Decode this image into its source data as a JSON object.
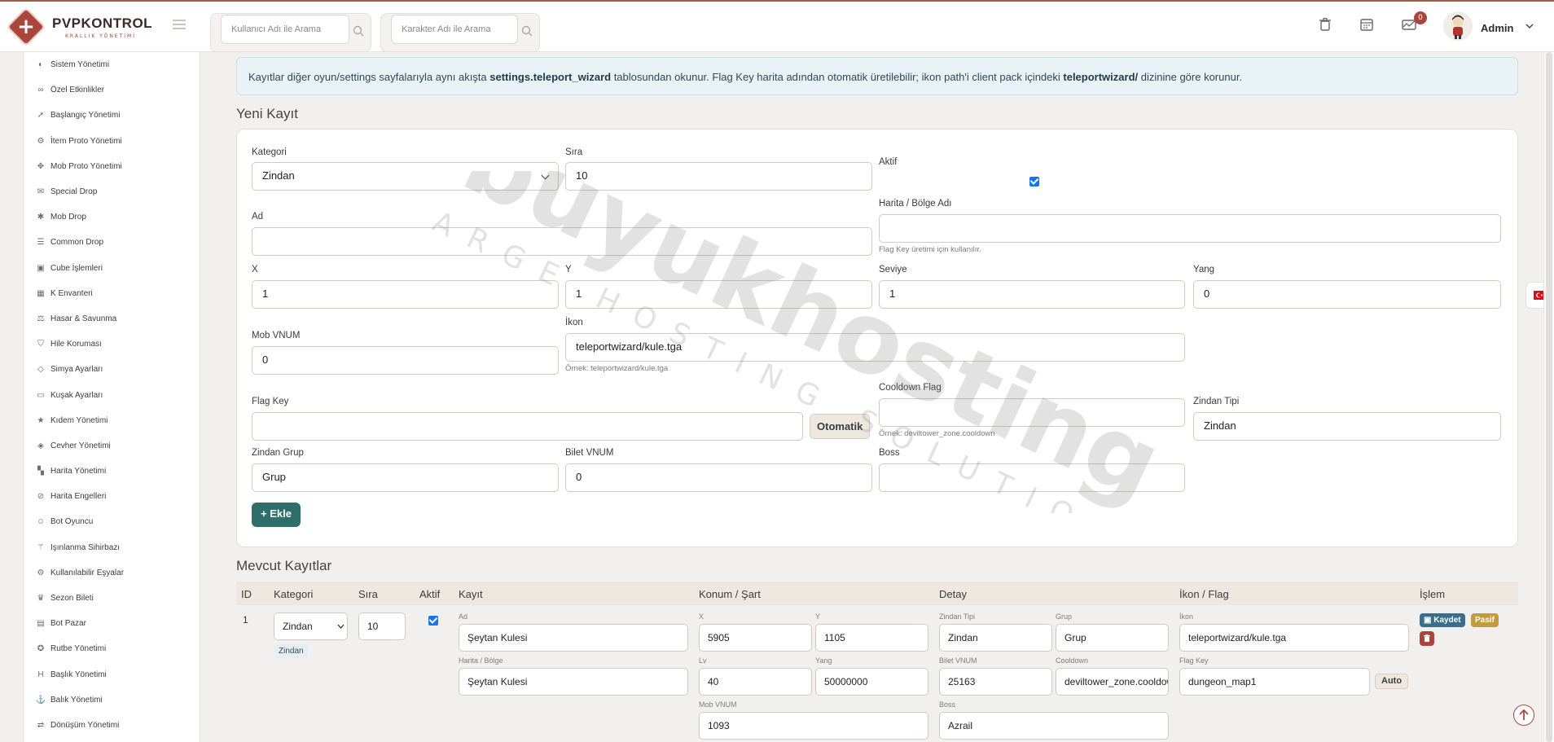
{
  "brand": {
    "title": "PVPKONTROL",
    "subtitle": "KRALLIK YÖNETİMİ"
  },
  "header": {
    "user_search_placeholder": "Kullanıcı Adı ile Arama",
    "char_search_placeholder": "Karakter Adı ile Arama",
    "notification_count": "0",
    "admin_name": "Admin"
  },
  "sidebar": {
    "items": [
      {
        "label": "Sistem Yönetimi",
        "icon": "toggle-icon"
      },
      {
        "label": "Özel Etkinlikler",
        "icon": "glasses-icon"
      },
      {
        "label": "Başlangıç Yönetimi",
        "icon": "rocket-icon"
      },
      {
        "label": "İtem Proto Yönetimi",
        "icon": "cog-icon"
      },
      {
        "label": "Mob Proto Yönetimi",
        "icon": "paw-icon"
      },
      {
        "label": "Special Drop",
        "icon": "gift-icon"
      },
      {
        "label": "Mob Drop",
        "icon": "bug-icon"
      },
      {
        "label": "Common Drop",
        "icon": "list-icon"
      },
      {
        "label": "Cube İşlemleri",
        "icon": "cube-icon"
      },
      {
        "label": "K Envanteri",
        "icon": "grid-icon"
      },
      {
        "label": "Hasar & Savunma",
        "icon": "balance-icon"
      },
      {
        "label": "Hile Koruması",
        "icon": "shield-icon"
      },
      {
        "label": "Simya Ayarları",
        "icon": "gem-icon"
      },
      {
        "label": "Kuşak Ayarları",
        "icon": "belt-icon"
      },
      {
        "label": "Kıdem Yönetimi",
        "icon": "star-icon"
      },
      {
        "label": "Cevher Yönetimi",
        "icon": "diamond-icon"
      },
      {
        "label": "Harita Yönetimi",
        "icon": "map-icon"
      },
      {
        "label": "Harita Engelleri",
        "icon": "ban-icon"
      },
      {
        "label": "Bot Oyuncu",
        "icon": "android-icon"
      },
      {
        "label": "Işınlanma Sihirbazı",
        "icon": "wand-icon"
      },
      {
        "label": "Kullanılabilir Eşyalar",
        "icon": "cogs-icon"
      },
      {
        "label": "Sezon Bileti",
        "icon": "trophy-icon"
      },
      {
        "label": "Bot Pazar",
        "icon": "basket-icon"
      },
      {
        "label": "Rutbe Yönetimi",
        "icon": "medal-icon"
      },
      {
        "label": "Başlık Yönetimi",
        "icon": "heading-icon"
      },
      {
        "label": "Balık Yönetimi",
        "icon": "anchor-icon"
      },
      {
        "label": "Dönüşüm Yönetimi",
        "icon": "exchange-icon"
      }
    ]
  },
  "info": {
    "part1": "Kayıtlar diğer oyun/settings sayfalarıyla aynı akışta ",
    "bold1": "settings.teleport_wizard",
    "part2": " tablosundan okunur. Flag Key harita adından otomatik üretilebilir; ikon path'i client pack içindeki ",
    "bold2": "teleportwizard/",
    "part3": " dizinine göre korunur."
  },
  "form": {
    "title": "Yeni Kayıt",
    "kategori_label": "Kategori",
    "kategori_value": "Zindan",
    "sira_label": "Sıra",
    "sira_value": "10",
    "aktif_label": "Aktif",
    "ad_label": "Ad",
    "ad_value": "",
    "harita_label": "Harita / Bölge Adı",
    "harita_value": "",
    "harita_help": "Flag Key üretimi için kullanılır.",
    "x_label": "X",
    "x_value": "1",
    "y_label": "Y",
    "y_value": "1",
    "seviye_label": "Seviye",
    "seviye_value": "1",
    "yang_label": "Yang",
    "yang_value": "0",
    "mob_label": "Mob VNUM",
    "mob_value": "0",
    "ikon_label": "İkon",
    "ikon_value": "teleportwizard/kule.tga",
    "ikon_help": "Örnek: teleportwizard/kule.tga",
    "flag_label": "Flag Key",
    "flag_value": "",
    "auto_label": "Otomatik",
    "cooldown_label": "Cooldown Flag",
    "cooldown_value": "",
    "cooldown_help": "Örnek: deviltower_zone.cooldown",
    "zindan_tipi_label": "Zindan Tipi",
    "zindan_tipi_value": "Zindan",
    "zindan_grup_label": "Zindan Grup",
    "zindan_grup_value": "Grup",
    "bilet_label": "Bilet VNUM",
    "bilet_value": "0",
    "boss_label": "Boss",
    "boss_value": "",
    "add_label": "Ekle"
  },
  "table": {
    "title": "Mevcut Kayıtlar",
    "headers": [
      "ID",
      "Kategori",
      "Sıra",
      "Aktif",
      "Kayıt",
      "Konum / Şart",
      "Detay",
      "İkon / Flag",
      "İşlem"
    ],
    "row": {
      "id": "1",
      "kategori": "Zindan",
      "kategori_chip": "Zindan",
      "sira": "10",
      "ad_label": "Ad",
      "ad": "Şeytan Kulesi",
      "harita_label": "Harita / Bölge",
      "harita": "Şeytan Kulesi",
      "x_label": "X",
      "x": "5905",
      "y_label": "Y",
      "y": "1105",
      "lv_label": "Lv",
      "lv": "40",
      "yang_label": "Yang",
      "yang": "50000000",
      "mob_label": "Mob VNUM",
      "mob": "1093",
      "tip_label": "Zindan Tipi",
      "tip": "Zindan",
      "grup_label": "Grup",
      "grup": "Grup",
      "bilet_label": "Bilet VNUM",
      "bilet": "25163",
      "cooldown_label": "Cooldown",
      "cooldown": "deviltower_zone.cooldown",
      "boss_label": "Boss",
      "boss": "Azrail",
      "ikon_label": "İkon",
      "ikon": "teleportwizard/kule.tga",
      "flag_label": "Flag Key",
      "flag": "dungeon_map1",
      "auto": "Auto",
      "save": "Kaydet",
      "pasif": "Pasif"
    }
  },
  "watermark": {
    "main": "buyukhosting",
    "sub": "LARGE HOSTING SOLUTIONS"
  },
  "colors": {
    "brand": "#a9453a",
    "teal": "#2f6f6b",
    "info_bg": "#e8f2f7",
    "table_header": "#ede7df"
  }
}
